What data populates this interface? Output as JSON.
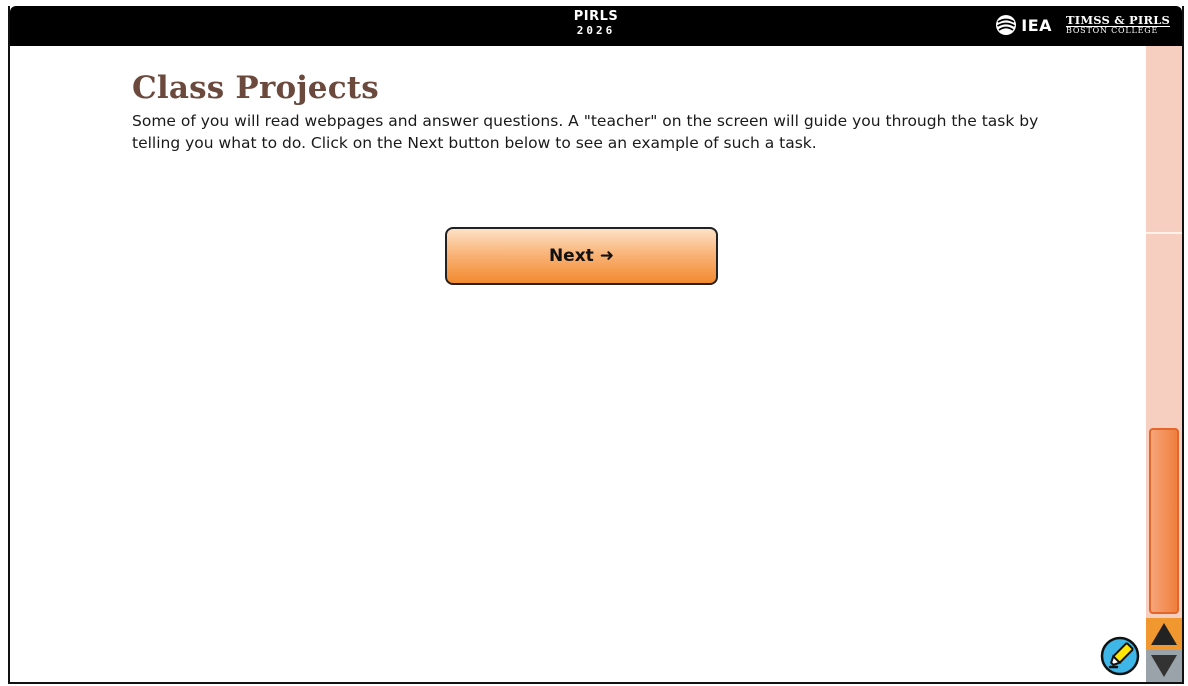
{
  "header": {
    "brand_name": "PIRLS",
    "brand_year": "2026",
    "iea_label": "IEA",
    "org_line1": "TIMSS & PIRLS",
    "org_line2": "BOSTON COLLEGE"
  },
  "main": {
    "title": "Class Projects",
    "description": "Some of you will read webpages and answer questions. A \"teacher\" on the screen will guide you through the task by telling you what to do. Click on the Next button below to see an example of such a task.",
    "next_label": "Next",
    "next_arrow": "➜"
  },
  "tools": {
    "highlighter_icon": "highlighter-pen-icon"
  },
  "colors": {
    "title": "#6b4a3d",
    "button_top": "#fde2c6",
    "button_bottom": "#f28a2e",
    "scroll_track": "#f7cfc0",
    "scroll_thumb": "#ef7f3d",
    "highlighter_blue": "#3eb6e8",
    "highlighter_yellow": "#ffe600"
  }
}
